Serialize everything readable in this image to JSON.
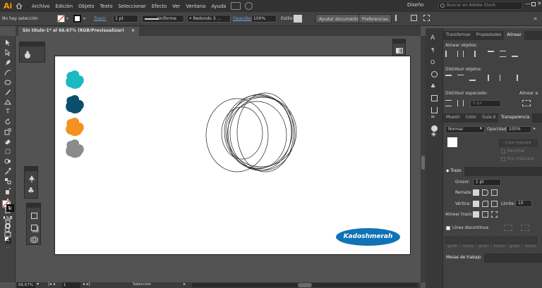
{
  "app": {
    "logo": "Ai",
    "workspace": "Diseño",
    "search_placeholder": "Buscar en Adobe Stock"
  },
  "menu": [
    "Archivo",
    "Edición",
    "Objeto",
    "Texto",
    "Seleccionar",
    "Efecto",
    "Ver",
    "Ventana",
    "Ayuda"
  ],
  "control": {
    "selection_status": "No hay selección",
    "stroke_label": "Trazo:",
    "stroke_weight": "1 pt",
    "profile": "Uniforme",
    "brush": "Redondo 3 ...",
    "opacity_label": "Opacidad:",
    "opacity_value": "100%",
    "style_label": "Estilo:",
    "adjust_doc": "Ajustar documento",
    "preferences": "Preferencias"
  },
  "document": {
    "tab_title": "Sin título-1* al 66.67% (RGB/Previsualizar)"
  },
  "artwork": {
    "blobs": [
      {
        "color": "#1bb9c2"
      },
      {
        "color": "#0b4d6d"
      },
      {
        "color": "#f39121"
      },
      {
        "color": "#8b8b8b"
      }
    ],
    "signature": "Kadoshmerah",
    "signature_bg": "#0f73b6"
  },
  "status": {
    "zoom": "66.67%",
    "artboard": "1",
    "tool": "Selección"
  },
  "panels": {
    "align": {
      "tabs": [
        "Transformar",
        "Propiedades",
        "Alinear"
      ],
      "align_objects": "Alinear objetos:",
      "distribute_objects": "Distribuir objetos:",
      "distribute_spacing": "Distribuir espaciado:",
      "align_to": "Alinear a:",
      "spacing_value": "0 px"
    },
    "transparency": {
      "tabs": [
        "Muestr",
        "Color",
        "Guía d",
        "Transparencia"
      ],
      "blend_mode": "Normal",
      "opacity_label": "Opacidad:",
      "opacity_value": "100%",
      "make_mask": "Crear máscara",
      "clip": "Recortar",
      "invert_mask": "Inv. máscara"
    },
    "stroke": {
      "title": "Trazo",
      "weight_label": "Grosor:",
      "weight_value": "1 pt",
      "cap_label": "Remate:",
      "corner_label": "Vértice:",
      "limit_label": "Límite:",
      "limit_value": "10",
      "align_label": "Alinear trazo:",
      "dashed_label": "Línea discontinua",
      "dash_fields": [
        "guión",
        "hueco",
        "guión",
        "hueco",
        "guión",
        "hueco"
      ]
    },
    "artboards": {
      "title": "Mesas de trabajo"
    }
  }
}
